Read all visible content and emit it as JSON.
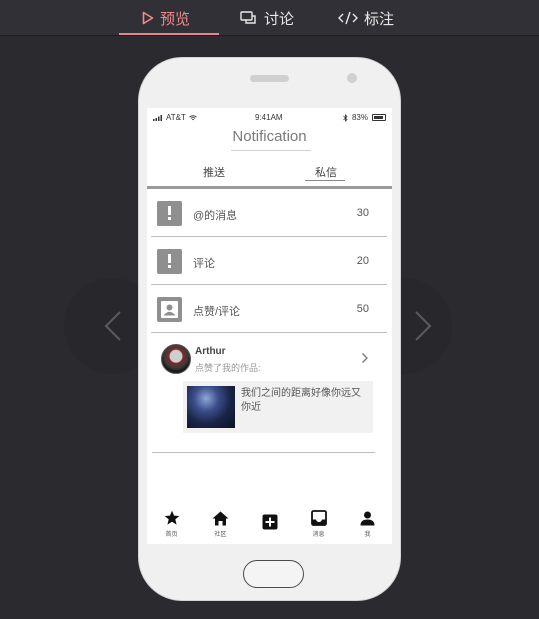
{
  "toolbar": {
    "tabs": [
      {
        "label": "预览",
        "icon": "play-outline-icon",
        "active": true
      },
      {
        "label": "讨论",
        "icon": "chat-bubbles-icon",
        "active": false
      },
      {
        "label": "标注",
        "icon": "code-icon",
        "active": false
      }
    ],
    "accent": "#f08a8a"
  },
  "status_bar": {
    "carrier": "AT&T",
    "time": "9:41AM",
    "battery": "83%"
  },
  "screen": {
    "title": "Notification",
    "segments": [
      "推送",
      "私信"
    ],
    "rows": [
      {
        "label": "@的消息",
        "count": "30",
        "icon": "alert-message-icon"
      },
      {
        "label": "评论",
        "count": "20",
        "icon": "alert-message-icon"
      },
      {
        "label": "点赞/评论",
        "count": "50",
        "icon": "contact-card-icon"
      }
    ],
    "card": {
      "user": "Arthur",
      "action": "点赞了我的作品:",
      "work_text": "我们之间的距离好像你远又你近"
    },
    "tabbar": [
      {
        "label": "首页",
        "icon": "star-icon"
      },
      {
        "label": "社区",
        "icon": "home-icon"
      },
      {
        "label": "",
        "icon": "add-box-icon"
      },
      {
        "label": "消息",
        "icon": "inbox-icon"
      },
      {
        "label": "我",
        "icon": "person-icon"
      }
    ]
  }
}
